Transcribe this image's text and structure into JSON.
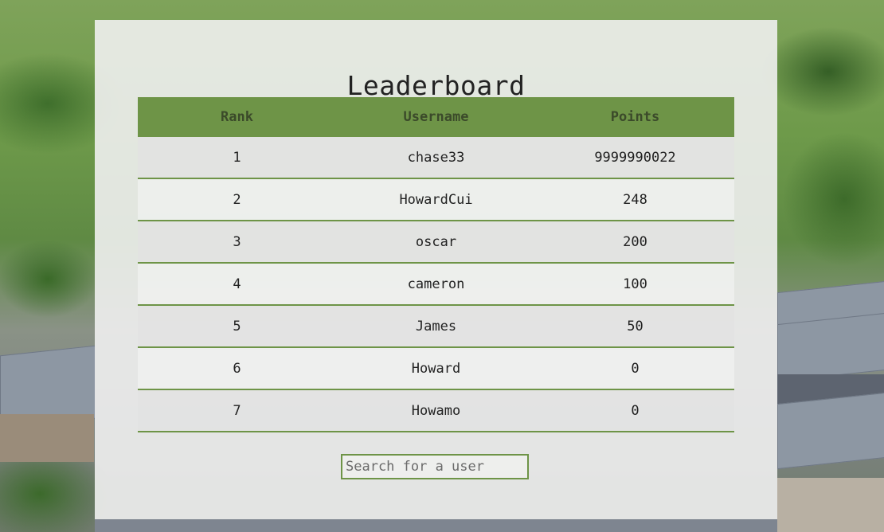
{
  "colors": {
    "accent": "#6e9447",
    "panel": "#f0f0ef",
    "text": "#222222"
  },
  "leaderboard": {
    "title": "Leaderboard",
    "headers": {
      "rank": "Rank",
      "username": "Username",
      "points": "Points"
    },
    "rows": [
      {
        "rank": "1",
        "username": "chase33",
        "points": "9999990022"
      },
      {
        "rank": "2",
        "username": "HowardCui",
        "points": "248"
      },
      {
        "rank": "3",
        "username": "oscar",
        "points": "200"
      },
      {
        "rank": "4",
        "username": "cameron",
        "points": "100"
      },
      {
        "rank": "5",
        "username": "James",
        "points": "50"
      },
      {
        "rank": "6",
        "username": "Howard",
        "points": "0"
      },
      {
        "rank": "7",
        "username": "Howamo",
        "points": "0"
      }
    ]
  },
  "search": {
    "placeholder": "Search for a user",
    "value": ""
  }
}
